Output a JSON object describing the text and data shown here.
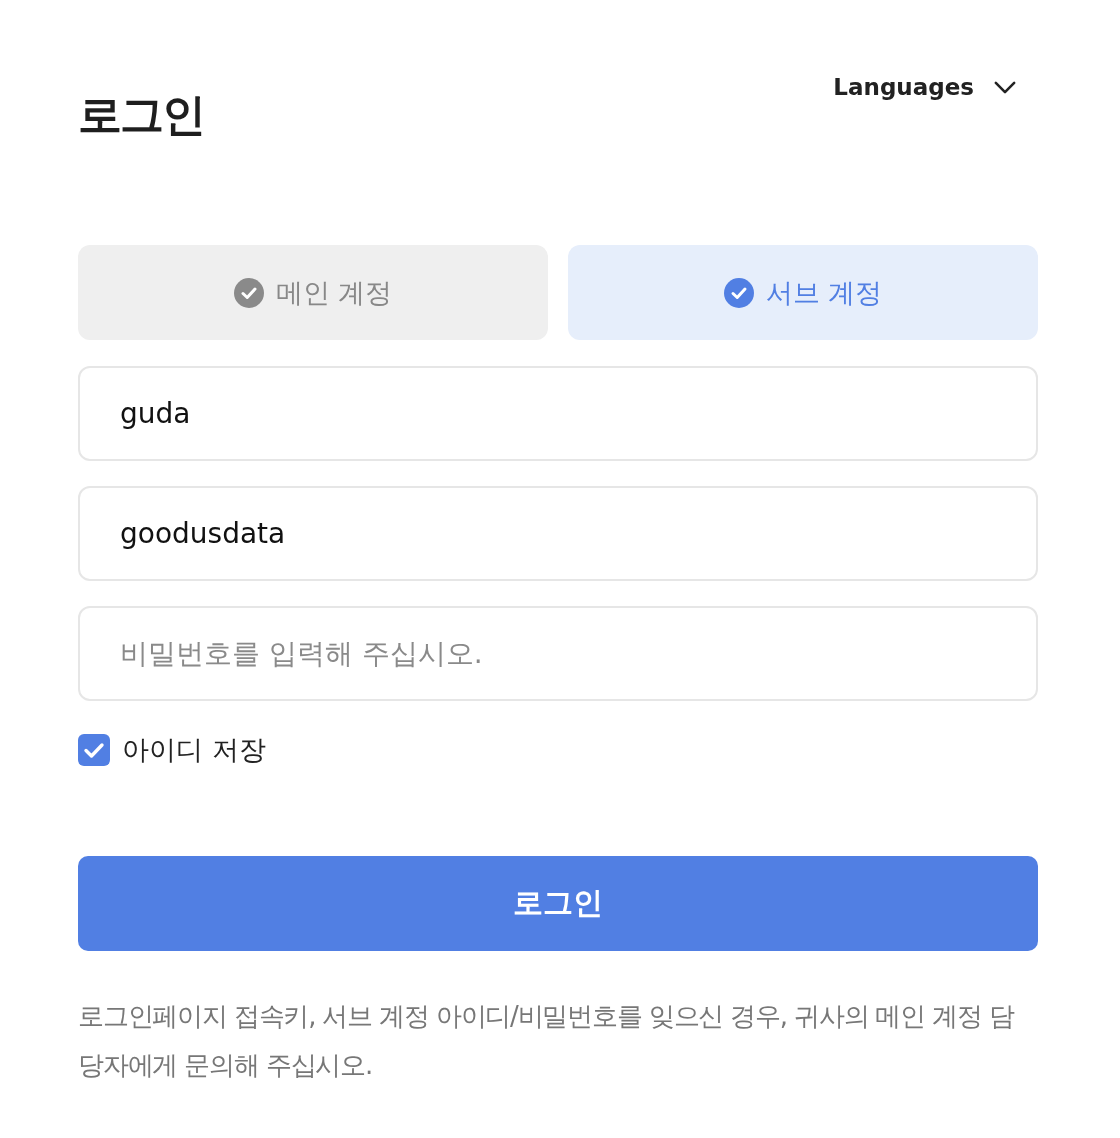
{
  "header": {
    "title": "로그인",
    "language_menu": {
      "label": "Languages"
    }
  },
  "account_tabs": [
    {
      "label": "메인 계정",
      "selected": false
    },
    {
      "label": "서브 계정",
      "selected": true
    }
  ],
  "fields": [
    {
      "value": "guda"
    },
    {
      "value": "goodusdata"
    },
    {
      "placeholder": "비밀번호를 입력해 주십시오."
    }
  ],
  "remember": {
    "label": "아이디 저장",
    "checked": true
  },
  "login_button": {
    "label": "로그인"
  },
  "notice": "로그인페이지 접속키, 서브 계정 아이디/비밀번호를 잊으신 경우, 귀사의 메인 계정 담당자에게 문의해 주십시오."
}
